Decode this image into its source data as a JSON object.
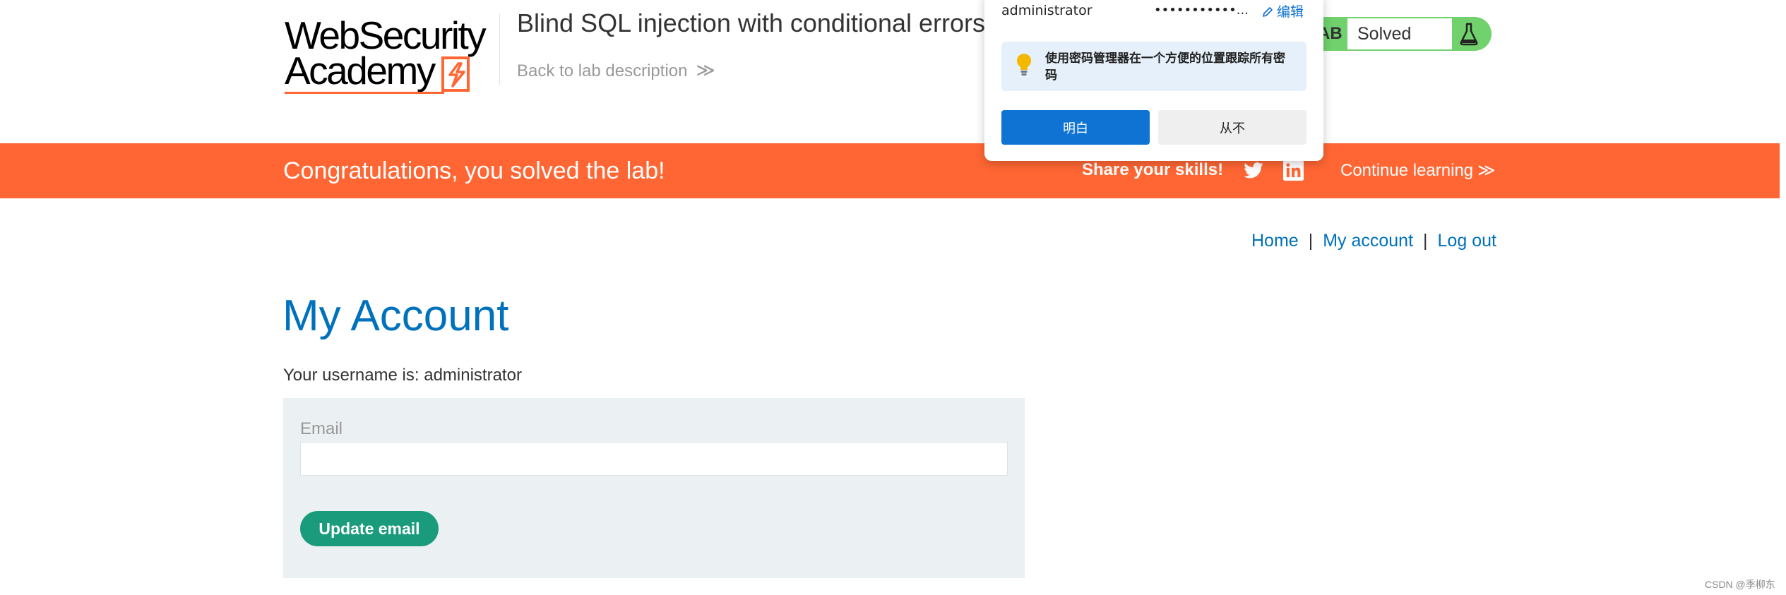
{
  "header": {
    "logo_line1": "WebSecurity",
    "logo_line2": "Academy",
    "lab_title": "Blind SQL injection with conditional errors",
    "back_link": "Back to lab description",
    "back_chevron": "≫",
    "status_prefix": "AB",
    "status": "Solved",
    "status_color": "#70d16d"
  },
  "banner": {
    "message": "Congratulations, you solved the lab!",
    "share": "Share your skills!",
    "twitter_icon": "twitter-icon",
    "linkedin_icon": "linkedin-icon",
    "continue": "Continue learning",
    "continue_chevron": "≫",
    "color": "#ff6633"
  },
  "nav": {
    "home": "Home",
    "separator": "|",
    "my_account": "My account",
    "log_out": "Log out"
  },
  "main": {
    "title": "My Account",
    "username_line": "Your username is: administrator",
    "email_label": "Email",
    "email_value": "",
    "update_button": "Update email",
    "button_color": "#1a9c7c"
  },
  "password_manager": {
    "username": "administrator",
    "password_mask": "•••••••••••...",
    "edit": "编辑",
    "tip": "使用密码管理器在一个方便的位置跟踪所有密码",
    "ok_button": "明白",
    "never_button": "从不",
    "accent": "#0e73d2"
  },
  "watermark": "CSDN @季柳东"
}
